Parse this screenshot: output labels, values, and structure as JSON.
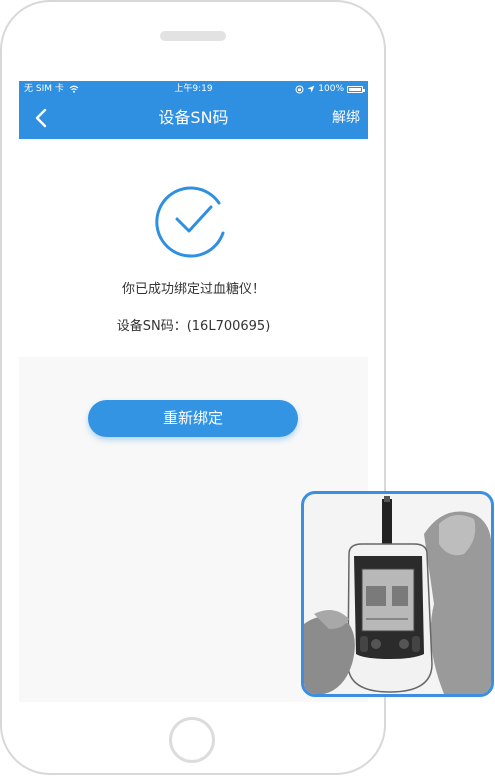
{
  "status_bar": {
    "carrier": "无 SIM 卡",
    "time": "上午9:19",
    "battery": "100%"
  },
  "nav": {
    "title": "设备SN码",
    "right_action": "解绑"
  },
  "content": {
    "success_message": "你已成功绑定过血糖仪！",
    "sn_text": "设备SN码：(16L700695)",
    "rebind_button": "重新绑定"
  },
  "colors": {
    "primary": "#2f8fe0",
    "button": "#3394e4",
    "inset_border": "#3a8fe0"
  },
  "icons": {
    "back": "chevron-left-icon",
    "success": "check-circle-icon",
    "wifi": "wifi-icon",
    "battery": "battery-icon",
    "location": "location-arrow-icon"
  }
}
